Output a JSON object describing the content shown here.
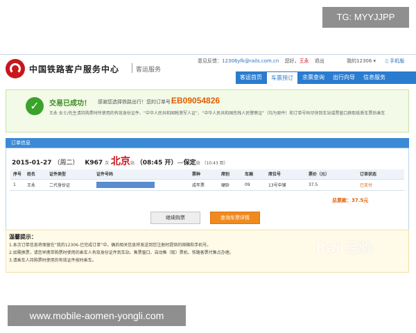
{
  "watermarks": {
    "top": "TG: MYYJJPP",
    "bottom": "www.mobile-aomen-yongli.com"
  },
  "header": {
    "brand": "中国铁路客户服务中心",
    "sub": "客运服务",
    "feedback_label": "意见反馈：",
    "feedback_email": "12306yfk@rails.com.cn",
    "greeting": "您好，",
    "user": "王永",
    "logout": "退出",
    "my12306": "我的12306 ▾",
    "mobile": "手机版"
  },
  "nav": {
    "tabs": [
      "客运首页",
      "车票预订",
      "余票查询",
      "出行向导",
      "信息服务"
    ],
    "active": 1
  },
  "success": {
    "title": "交易已成功！",
    "thanks": "感谢您选择铁路出行！您的订单号：",
    "order_no": "EB09054826",
    "note": "王永 女士/先生请持购票时所使用的有效身份证件、“中华人民共和国税港军人证”、“中华人民共和国伤残人民警察证”（均为原件）和订单号码尽快到车站或票窗口换取纸质车票后乘车"
  },
  "order": {
    "header": "订单信息",
    "date": "2015-01-27",
    "weekday": "（周二）",
    "train": "K967",
    "train_suffix": "次",
    "from": "北京",
    "from_suffix": "站",
    "depart": "（08:45 开）",
    "to": "保定",
    "to_suffix": "站",
    "arrive": "（10:43 到）",
    "columns": [
      "序号",
      "姓名",
      "证件类型",
      "证件号码",
      "票种",
      "席别",
      "车厢",
      "席位号",
      "票价（元）",
      "订单状态"
    ],
    "rows": [
      {
        "no": "1",
        "name": "王永",
        "id_type": "二代身份证",
        "ticket_type": "成年票",
        "seat_class": "硬卧",
        "car": "09",
        "seat": "13号中铺",
        "price": "37.5",
        "status": "已支付"
      }
    ],
    "total_label": "总票款：",
    "total": "37.5元"
  },
  "buttons": {
    "continue": "继续购票",
    "query": "查询车票详情"
  },
  "tips": {
    "title": "温馨提示：",
    "items": [
      "1.本次订单信息将保留在“我的12306-已完成订单”中，确后相关信息将发送到您注册时提供的邮箱和手机号。",
      "2.如需换票，请您早携带购票时使用的乘车人有效身份证件到车站、售票窗口、自动售（取）票机、铁路客票代售点办理。",
      "3.请乘车人持购票时使用的有效证件按时乘车。"
    ]
  },
  "baidu_mark": "Bai 经验"
}
